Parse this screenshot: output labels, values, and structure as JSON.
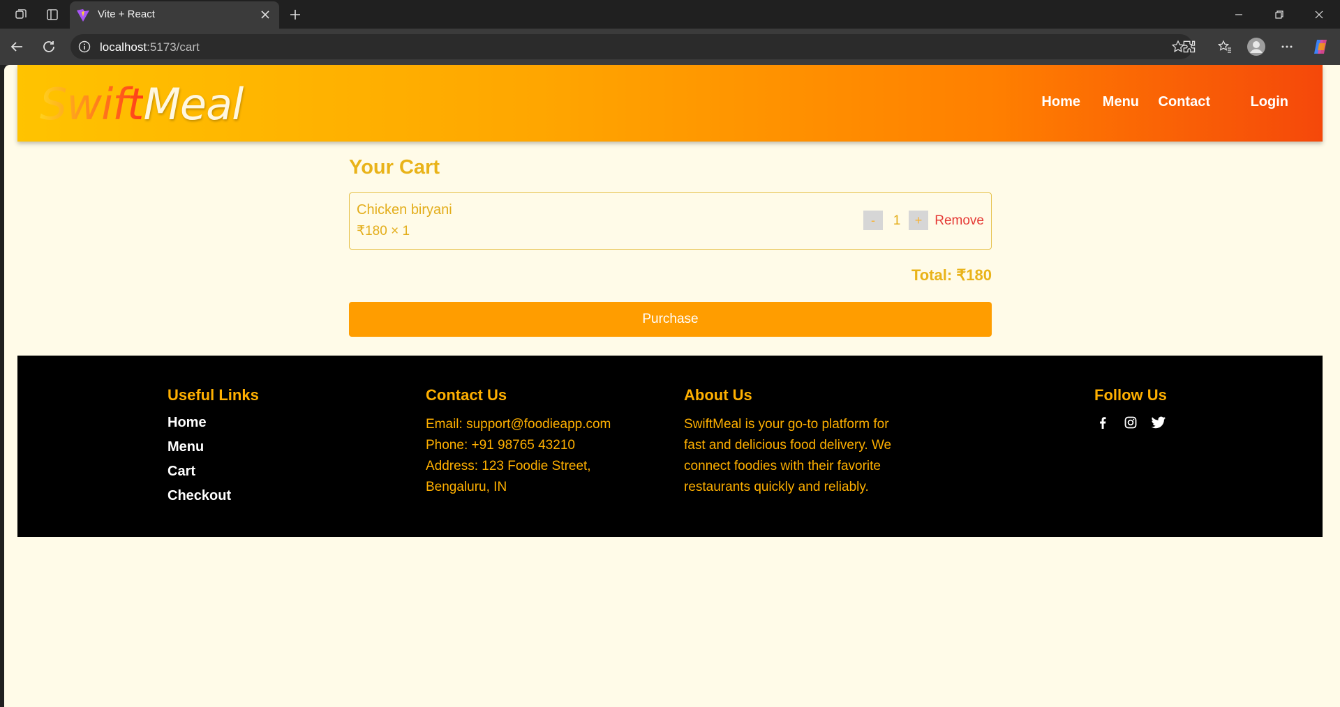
{
  "browser": {
    "tab_title": "Vite + React",
    "url_host": "localhost",
    "url_path": ":5173/cart"
  },
  "header": {
    "logo_part1": "Swift",
    "logo_part2": "Meal",
    "nav": [
      "Home",
      "Menu",
      "Contact",
      "Login"
    ]
  },
  "cart": {
    "title": "Your Cart",
    "items": [
      {
        "name": "Chicken biryani",
        "price_line": "₹180 × 1",
        "decrement": "-",
        "quantity": "1",
        "increment": "+",
        "remove": "Remove"
      }
    ],
    "total": "Total: ₹180",
    "purchase": "Purchase"
  },
  "footer": {
    "useful_links": {
      "heading": "Useful Links",
      "links": [
        "Home",
        "Menu",
        "Cart",
        "Checkout"
      ]
    },
    "contact": {
      "heading": "Contact Us",
      "email": "Email: support@foodieapp.com",
      "phone": "Phone: +91 98765 43210",
      "address_line1": "Address: 123 Foodie Street,",
      "address_line2": "Bengaluru, IN"
    },
    "about": {
      "heading": "About Us",
      "lines": [
        "SwiftMeal is your go-to platform for",
        "fast and delicious food delivery. We",
        "connect foodies with their favorite",
        "restaurants quickly and reliably."
      ]
    },
    "follow": {
      "heading": "Follow Us",
      "icons": [
        "facebook-icon",
        "instagram-icon",
        "twitter-icon"
      ]
    }
  },
  "colors": {
    "accent": "#ffb000",
    "purchase": "#ff9d00",
    "remove": "#e53935",
    "page_bg": "#fffbe8"
  }
}
